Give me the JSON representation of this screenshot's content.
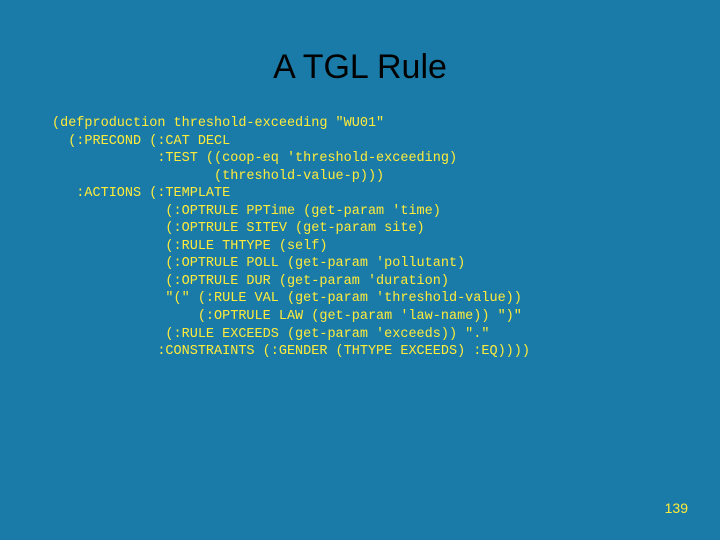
{
  "title": "A TGL Rule",
  "code": "(defproduction threshold-exceeding \"WU01\"\n  (:PRECOND (:CAT DECL\n             :TEST ((coop-eq 'threshold-exceeding)\n                    (threshold-value-p)))\n   :ACTIONS (:TEMPLATE\n              (:OPTRULE PPTime (get-param 'time)\n              (:OPTRULE SITEV (get-param site)\n              (:RULE THTYPE (self)\n              (:OPTRULE POLL (get-param 'pollutant)\n              (:OPTRULE DUR (get-param 'duration)\n              \"(\" (:RULE VAL (get-param 'threshold-value))\n                  (:OPTRULE LAW (get-param 'law-name)) \")\"\n              (:RULE EXCEEDS (get-param 'exceeds)) \".\"\n             :CONSTRAINTS (:GENDER (THTYPE EXCEEDS) :EQ))))",
  "page_number": "139"
}
